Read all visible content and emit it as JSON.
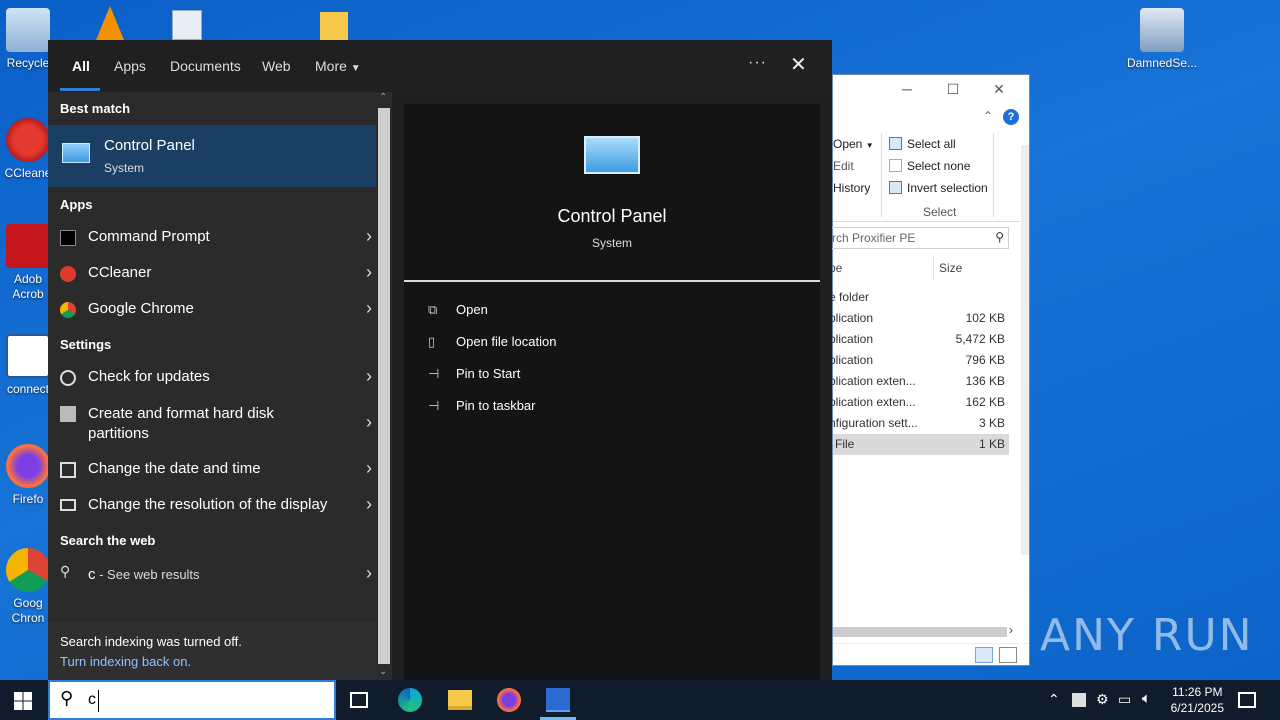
{
  "desktop": {
    "icons": [
      {
        "label": "Recycle"
      },
      {
        "label": "CCleane"
      },
      {
        "label": "Adob\nAcrob"
      },
      {
        "label": "connect"
      },
      {
        "label": "Firefo"
      },
      {
        "label": "Goog\nChron"
      },
      {
        "label": "DamnedSe..."
      }
    ]
  },
  "explorer": {
    "ribbon": {
      "open": "Open",
      "edit": "Edit",
      "history": "History",
      "select_all": "Select all",
      "select_none": "Select none",
      "invert_selection": "Invert selection",
      "group_label": "Select"
    },
    "search_placeholder": "rch Proxifier PE",
    "columns": {
      "type": "pe",
      "size": "Size"
    },
    "rows": [
      {
        "type": "e folder",
        "size": ""
      },
      {
        "type": "plication",
        "size": "102 KB"
      },
      {
        "type": "plication",
        "size": "5,472 KB"
      },
      {
        "type": "plication",
        "size": "796 KB"
      },
      {
        "type": "plication exten...",
        "size": "136 KB"
      },
      {
        "type": "plication exten...",
        "size": "162 KB"
      },
      {
        "type": "nfiguration sett...",
        "size": "3 KB"
      },
      {
        "type": "File",
        "size": "1 KB"
      }
    ]
  },
  "search": {
    "tabs": [
      "All",
      "Apps",
      "Documents",
      "Web",
      "More"
    ],
    "more_icon": "more-options-icon",
    "close_icon": "close-icon",
    "best_match_heading": "Best match",
    "best_match": {
      "title": "Control Panel",
      "subtitle": "System"
    },
    "apps_heading": "Apps",
    "apps": [
      {
        "label": "Command Prompt",
        "icon": "command-prompt-icon"
      },
      {
        "label": "CCleaner",
        "icon": "ccleaner-icon"
      },
      {
        "label": "Google Chrome",
        "icon": "chrome-icon"
      }
    ],
    "settings_heading": "Settings",
    "settings": [
      {
        "label": "Check for updates",
        "icon": "refresh-icon"
      },
      {
        "label": "Create and format hard disk partitions",
        "icon": "disk-icon"
      },
      {
        "label": "Change the date and time",
        "icon": "calendar-icon"
      },
      {
        "label": "Change the resolution of the display",
        "icon": "display-icon"
      }
    ],
    "web_heading": "Search the web",
    "web_result": {
      "query": "c",
      "suffix": " - See web results"
    },
    "footer": {
      "message": "Search indexing was turned off.",
      "link": "Turn indexing back on."
    },
    "detail": {
      "title": "Control Panel",
      "subtitle": "System",
      "actions": [
        {
          "label": "Open",
          "icon": "open-icon"
        },
        {
          "label": "Open file location",
          "icon": "file-location-icon"
        },
        {
          "label": "Pin to Start",
          "icon": "pin-icon"
        },
        {
          "label": "Pin to taskbar",
          "icon": "pin-icon"
        }
      ]
    }
  },
  "taskbar": {
    "search_value": "c",
    "time": "11:26 PM",
    "date": "6/21/2025"
  },
  "watermark": "ANY RUN"
}
